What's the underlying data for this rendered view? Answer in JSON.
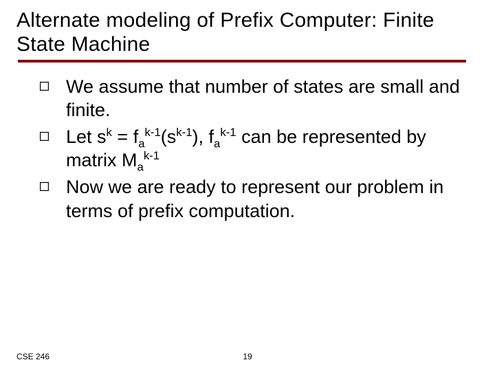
{
  "title": "Alternate modeling of Prefix Computer: Finite State Machine",
  "bullets": {
    "b1": "We assume that number of states are small and finite.",
    "b2_pre": "Let s",
    "b2_mid1": " = f",
    "b2_mid2": "(s",
    "b2_mid3": "), f",
    "b2_mid4": " can be represented by matrix M",
    "b3": "Now we are ready to represent our problem in terms of prefix computation.",
    "sup_k": "k",
    "sup_km1": "k-1",
    "sub_a": "a"
  },
  "footer": {
    "course": "CSE 246",
    "page": "19"
  }
}
